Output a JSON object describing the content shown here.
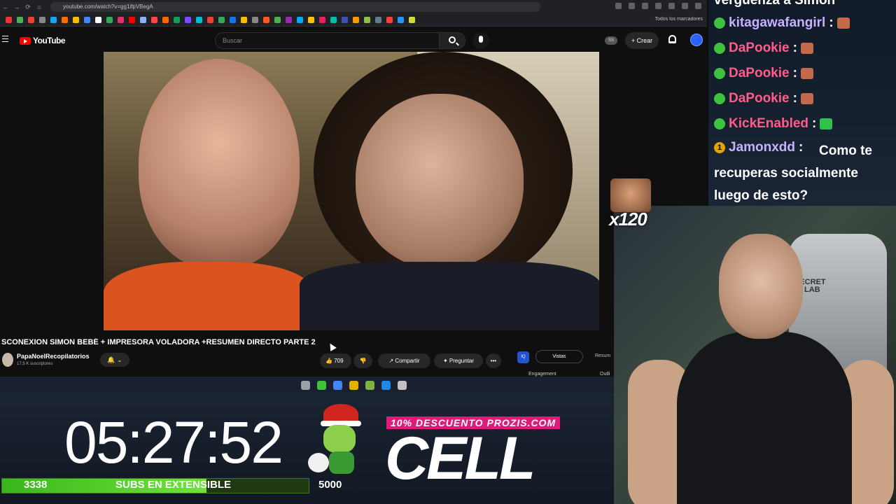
{
  "browser": {
    "url": "youtube.com/watch?v=gg1ifpVBegA",
    "bookmarks_folder": "Todos los marcadores",
    "bookmark_colors": [
      "#e33",
      "#4caf50",
      "#ea4335",
      "#888",
      "#1da1f2",
      "#ff6d00",
      "#fbbc04",
      "#4285f4",
      "#ffffff",
      "#34a853",
      "#e1306c",
      "#ff0000",
      "#8ab4f8",
      "#f44",
      "#ff6600",
      "#0f9d58",
      "#7c4dff",
      "#00bcd4",
      "#ea4335",
      "#34a853",
      "#1a73e8",
      "#fbbc04",
      "#888",
      "#ff5722",
      "#4caf50",
      "#9c27b0",
      "#03a9f4",
      "#ffc107",
      "#e91e63",
      "#00bfa5",
      "#3f51b5",
      "#ff9800",
      "#8bc34a",
      "#607d8b",
      "#f44336",
      "#2196f3",
      "#cddc39"
    ]
  },
  "youtube": {
    "logo_text": "YouTube",
    "search_placeholder": "Buscar",
    "ss_badge": "SS",
    "create_label": "Crear",
    "video_title": "SCONEXION SIMON BEBÉ + IMPRESORA VOLADORA +RESUMEN DIRECTO PARTE 2",
    "channel_name": "PapaNoelRecopilatorios",
    "channel_subs": "17,5 K suscriptores",
    "subscribe_bell": "🔔 ⌄",
    "likes": "709",
    "share_label": "Compartir",
    "ask_label": "Preguntar",
    "more_label": "•••",
    "ext_label": "IQ",
    "tab_vistas": "Vistas",
    "tab_resumen": "Resum",
    "engagement_label": "Engagement",
    "outlier_label": "Outli"
  },
  "taskbar_colors": [
    "#9aa0a6",
    "#3ec23e",
    "#4285f4",
    "#e2b100",
    "#7cb342",
    "#1e88e5",
    "#c0c0c0"
  ],
  "chat": {
    "top_text": "verguenza a Simon",
    "messages": [
      {
        "user": "kitagawafangirl",
        "sep": " :",
        "color": "light"
      },
      {
        "user": "DaPookie",
        "sep": " :",
        "color": "pink"
      },
      {
        "user": "DaPookie",
        "sep": " :",
        "color": "pink"
      },
      {
        "user": "DaPookie",
        "sep": " :",
        "color": "pink"
      },
      {
        "user": "KickEnabled",
        "sep": " :",
        "color": "pink"
      }
    ],
    "last_user": "Jamonxdd",
    "last_message": "Como te recuperas socialmente luego de esto?",
    "badge_sub": "1"
  },
  "webcam": {
    "chair_logo_1": "SECRET",
    "chair_logo_2": "LAB"
  },
  "overlay": {
    "emote_count": "x120"
  },
  "stream": {
    "timer": "05:27:52",
    "subs_current": "3338",
    "subs_label": "SUBS EN EXTENSIBLE",
    "subs_goal": "5000",
    "subs_progress": 0.6676,
    "promo_text": "10% DESCUENTO PROZIS.COM",
    "brand_text": "CELL"
  }
}
